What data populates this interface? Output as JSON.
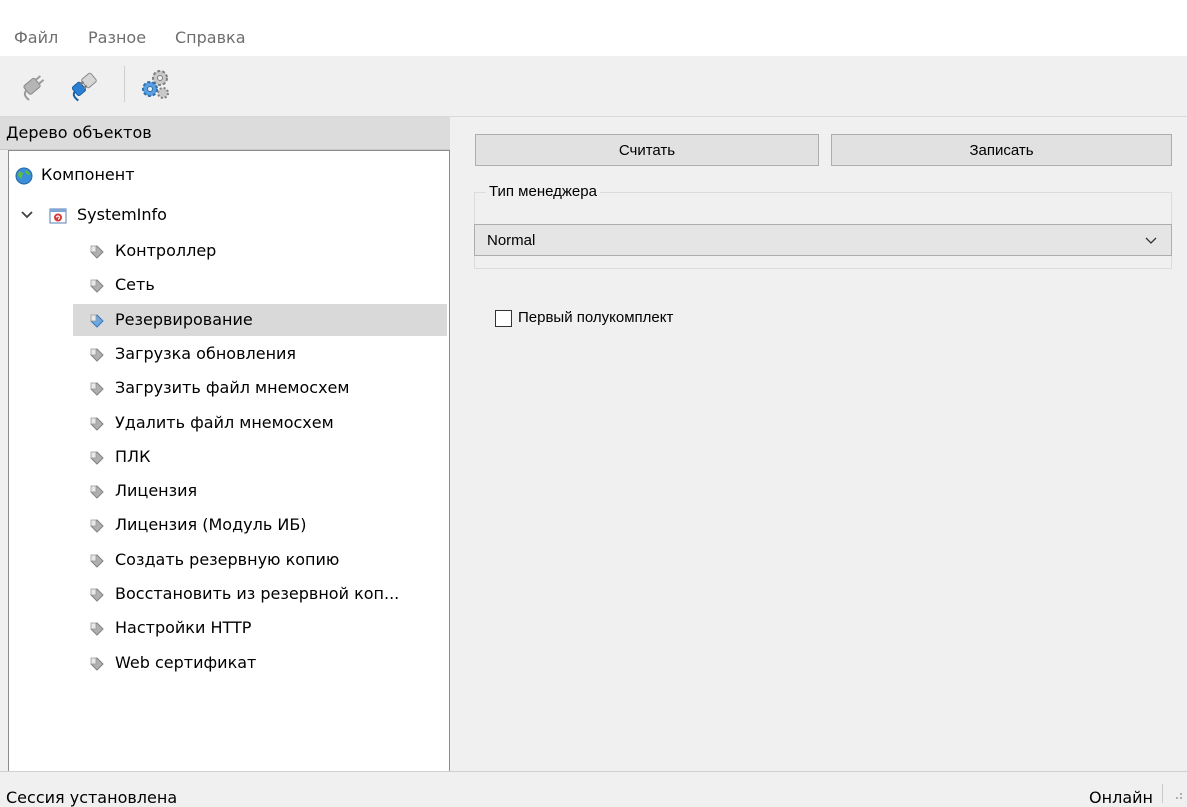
{
  "menu": [
    "Файл",
    "Разное",
    "Справка"
  ],
  "toolbar": {
    "icons": [
      "disconnect-plug-icon",
      "connect-plug-icon",
      "settings-gears-icon"
    ]
  },
  "tree": {
    "header": "Дерево объектов",
    "root": "Компонент",
    "node": "SystemInfo",
    "children": [
      "Контроллер",
      "Сеть",
      "Резервирование",
      "Загрузка обновления",
      "Загрузить файл мнемосхем",
      "Удалить файл мнемосхем",
      "ПЛК",
      "Лицензия",
      "Лицензия (Модуль ИБ)",
      "Создать резервную копию",
      "Восстановить из резервной коп...",
      "Настройки HTTP",
      "Web сертификат"
    ],
    "selected": "Резервирование"
  },
  "panel": {
    "read_button": "Считать",
    "write_button": "Записать",
    "group_title": "Тип менеджера",
    "combo_value": "Normal",
    "checkbox_label": "Первый полукомплект",
    "checkbox_checked": false
  },
  "status": {
    "left": "Сессия установлена",
    "right": "Онлайн"
  },
  "colors": {
    "selection": "#d9d9d9",
    "accent_blue": "#2a7fd4"
  }
}
